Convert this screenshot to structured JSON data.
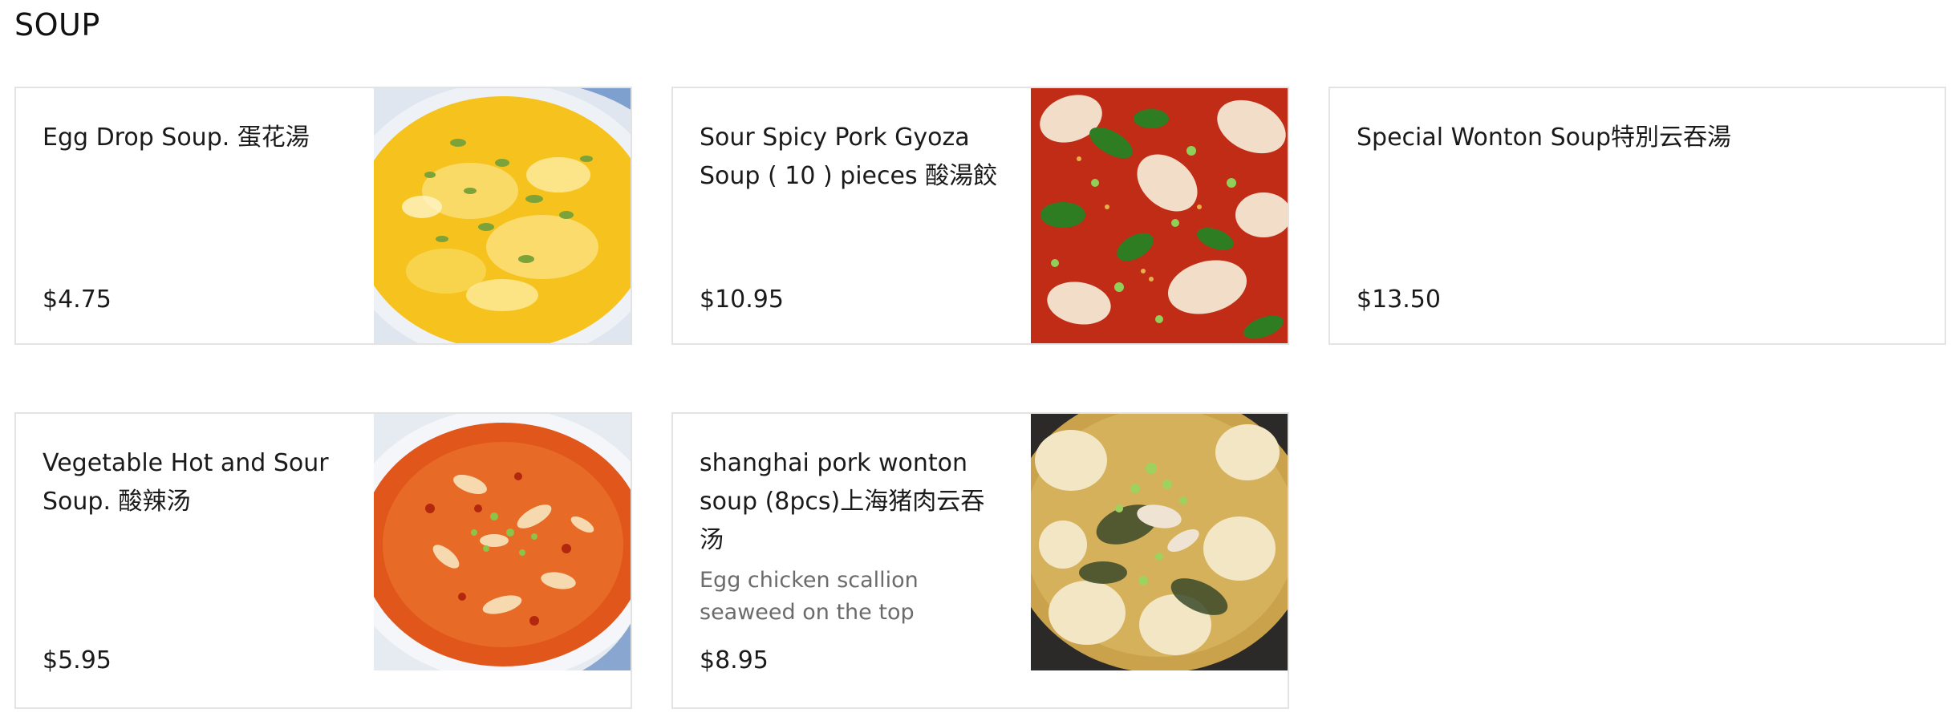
{
  "section": {
    "title": "SOUP"
  },
  "items": [
    {
      "name_line1": "Egg Drop Soup. 蛋花湯",
      "name_line2": "",
      "name_line3": "",
      "description_line1": "",
      "description_line2": "",
      "price": "$4.75",
      "has_image": true,
      "image": "egg-drop-soup-photo"
    },
    {
      "name_line1": "Sour Spicy Pork Gyoza",
      "name_line2": "Soup ( 10 ) pieces 酸湯餃",
      "name_line3": "",
      "description_line1": "",
      "description_line2": "",
      "price": "$10.95",
      "has_image": true,
      "image": "sour-spicy-gyoza-photo"
    },
    {
      "name_line1": "Special Wonton Soup特別云吞湯",
      "name_line2": "",
      "name_line3": "",
      "description_line1": "",
      "description_line2": "",
      "price": "$13.50",
      "has_image": false,
      "image": ""
    },
    {
      "name_line1": "Vegetable Hot and Sour",
      "name_line2": "Soup. 酸辣汤",
      "name_line3": "",
      "description_line1": "",
      "description_line2": "",
      "price": "$5.95",
      "has_image": true,
      "image": "hot-and-sour-soup-photo"
    },
    {
      "name_line1": "shanghai pork wonton",
      "name_line2": "soup (8pcs)上海猪肉云吞",
      "name_line3": "汤",
      "description_line1": "Egg chicken scallion",
      "description_line2": "seaweed on the top",
      "price": "$8.95",
      "has_image": true,
      "image": "shanghai-wonton-soup-photo"
    }
  ]
}
